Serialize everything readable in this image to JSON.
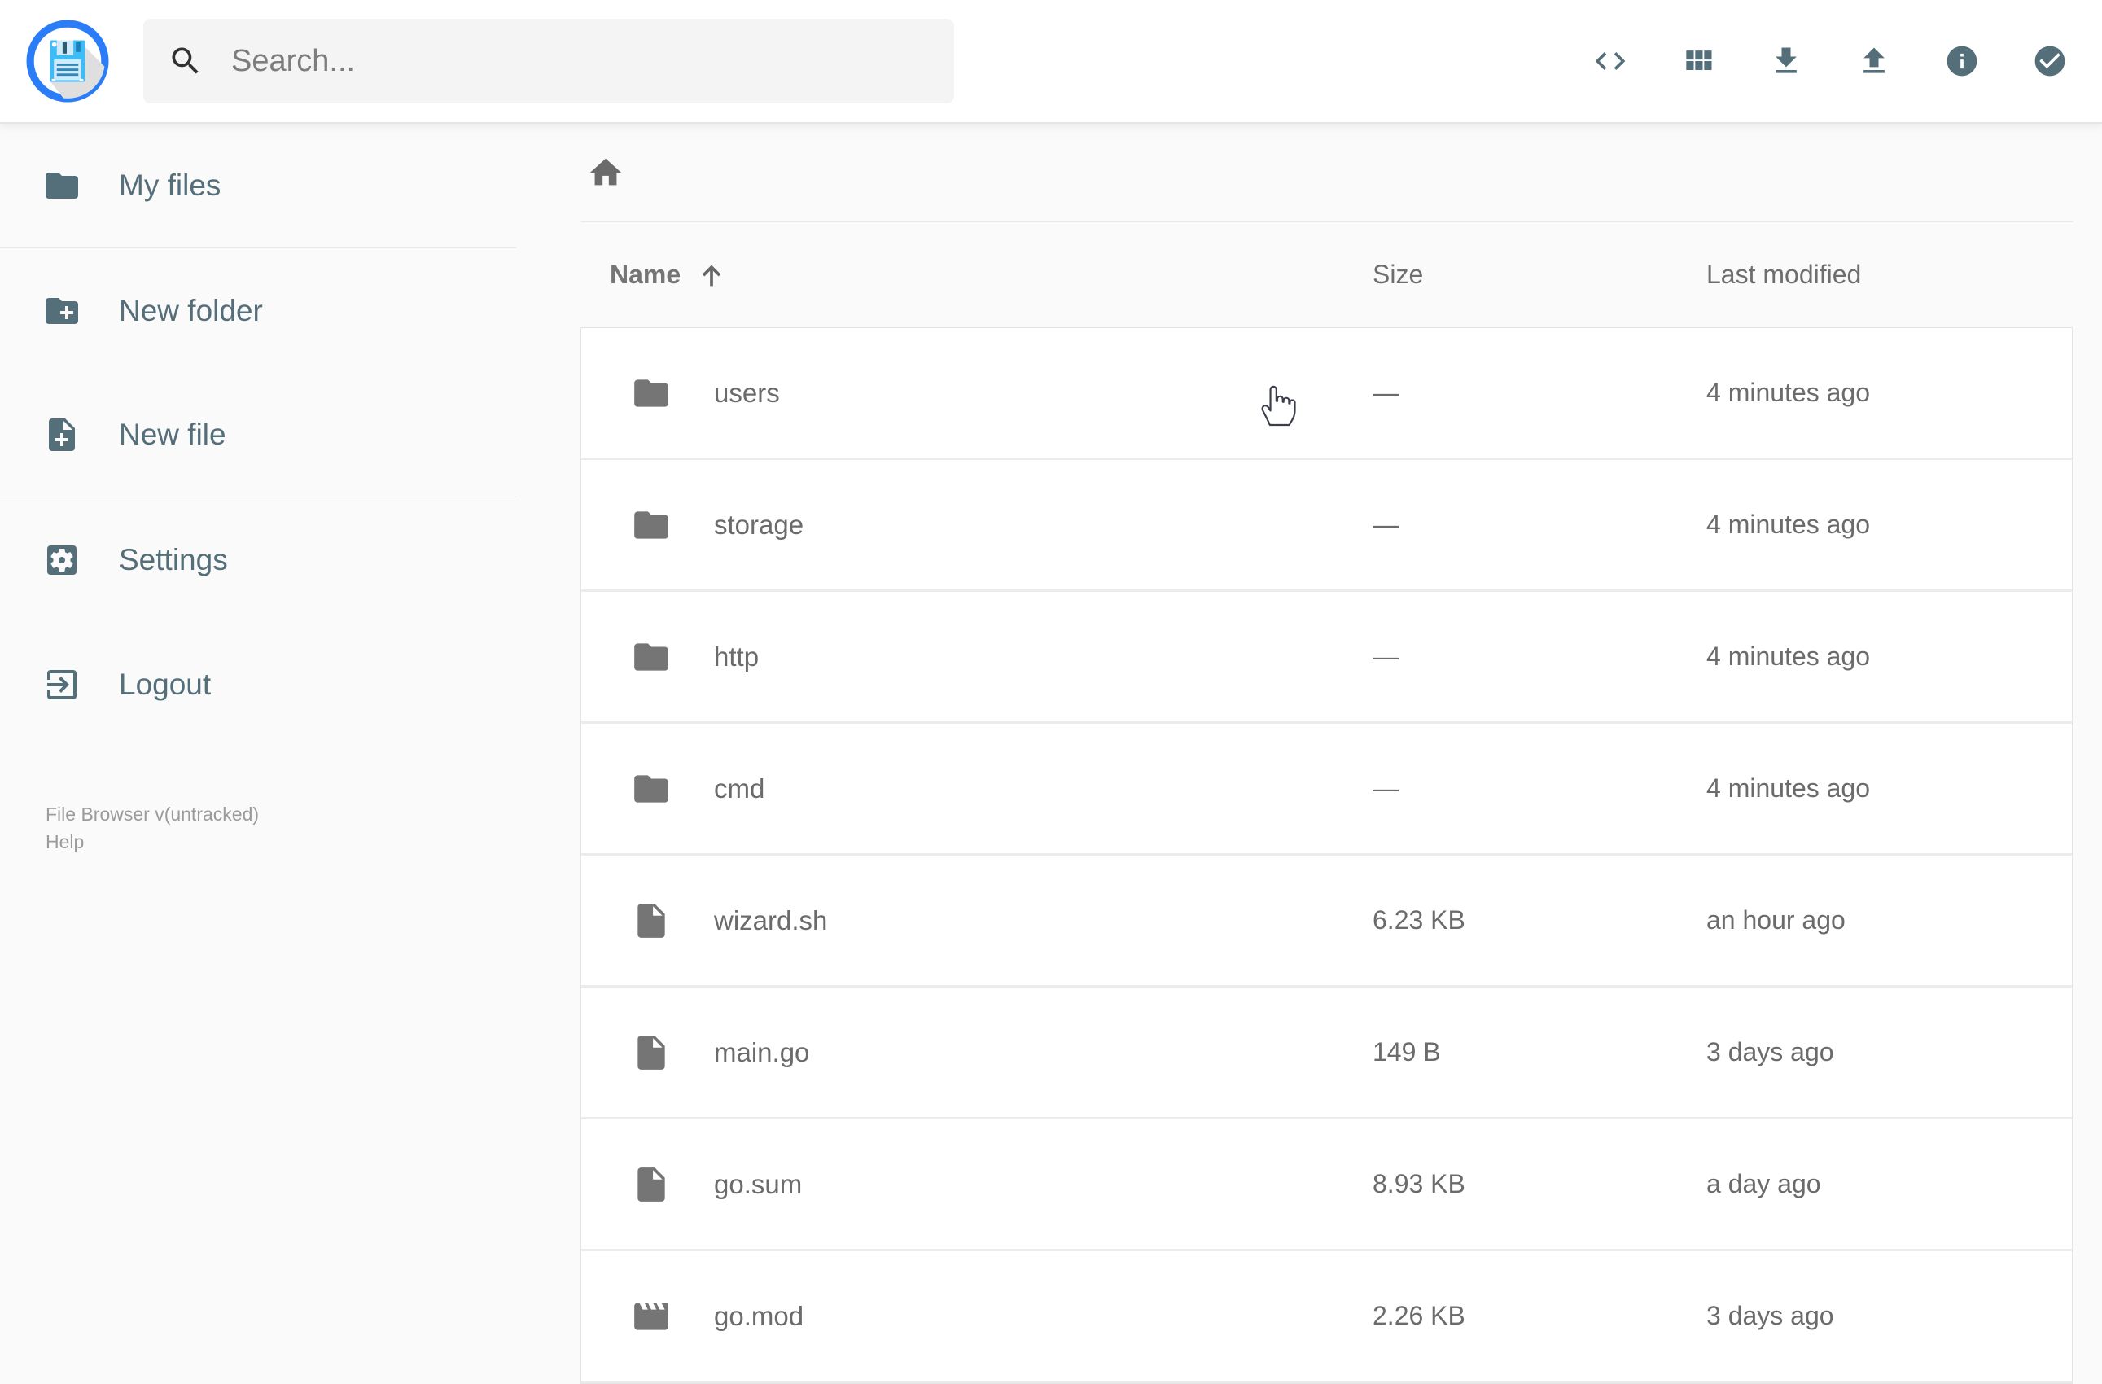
{
  "app": {
    "logo_icon": "floppy-disk-logo"
  },
  "header": {
    "search": {
      "placeholder": "Search...",
      "icon": "search"
    },
    "actions": [
      {
        "name": "shell",
        "icon": "code"
      },
      {
        "name": "switch-view",
        "icon": "grid-view"
      },
      {
        "name": "download",
        "icon": "download"
      },
      {
        "name": "upload",
        "icon": "upload"
      },
      {
        "name": "info",
        "icon": "info"
      },
      {
        "name": "select-multiple",
        "icon": "check-circle"
      }
    ]
  },
  "sidebar": {
    "items": [
      {
        "label": "My files",
        "icon": "folder",
        "divider_after": true
      },
      {
        "label": "New folder",
        "icon": "folder-plus",
        "divider_after": false
      },
      {
        "label": "New file",
        "icon": "file-plus",
        "divider_after": true
      },
      {
        "label": "Settings",
        "icon": "settings",
        "divider_after": false
      },
      {
        "label": "Logout",
        "icon": "logout",
        "divider_after": false
      }
    ],
    "footer": {
      "version": "File Browser v(untracked)",
      "help": "Help"
    }
  },
  "breadcrumb": {
    "home_icon": "home"
  },
  "listing": {
    "columns": {
      "name": "Name",
      "size": "Size",
      "modified": "Last modified"
    },
    "sort": {
      "column": "name",
      "direction": "asc",
      "icon": "arrow-up"
    },
    "rows": [
      {
        "name": "users",
        "type": "folder",
        "size": "—",
        "modified": "4 minutes ago"
      },
      {
        "name": "storage",
        "type": "folder",
        "size": "—",
        "modified": "4 minutes ago"
      },
      {
        "name": "http",
        "type": "folder",
        "size": "—",
        "modified": "4 minutes ago"
      },
      {
        "name": "cmd",
        "type": "folder",
        "size": "—",
        "modified": "4 minutes ago"
      },
      {
        "name": "wizard.sh",
        "type": "file",
        "size": "6.23 KB",
        "modified": "an hour ago"
      },
      {
        "name": "main.go",
        "type": "file",
        "size": "149 B",
        "modified": "3 days ago"
      },
      {
        "name": "go.sum",
        "type": "file",
        "size": "8.93 KB",
        "modified": "a day ago"
      },
      {
        "name": "go.mod",
        "type": "movie",
        "size": "2.26 KB",
        "modified": "3 days ago"
      }
    ]
  },
  "colors": {
    "accent_blue": "#2a7cf7",
    "logo_cyan": "#3ebcf6",
    "slate": "#546e7a",
    "row_text": "#6b6b6b",
    "background": "#fafafa"
  }
}
